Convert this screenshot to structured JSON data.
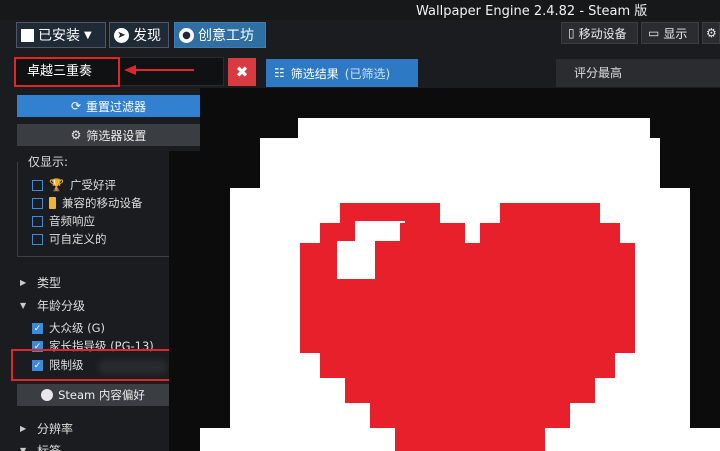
{
  "window": {
    "title": "Wallpaper Engine 2.4.82 - Steam 版"
  },
  "tabs": [
    {
      "label": "已安装",
      "icon": "save-icon",
      "active": false
    },
    {
      "label": "发现",
      "icon": "compass-icon",
      "active": false
    },
    {
      "label": "创意工坊",
      "icon": "steam-icon",
      "active": true
    }
  ],
  "right_buttons": {
    "mobile": "移动设备",
    "display": "显示"
  },
  "search": {
    "value": "卓越三重奏"
  },
  "filter_results": {
    "label": "筛选结果",
    "status": "(已筛选)"
  },
  "sort": {
    "selected": "评分最高"
  },
  "left": {
    "reset_label": "重置过滤器",
    "settings_label": "筛选器设置",
    "show_only_title": "仅显示:",
    "show_only": [
      {
        "label": "广受好评",
        "icon": "trophy-icon"
      },
      {
        "label": "兼容的移动设备",
        "icon": "phone-icon"
      },
      {
        "label": "音频响应",
        "icon": ""
      },
      {
        "label": "可自定义的",
        "icon": ""
      }
    ],
    "sections": {
      "type": "类型",
      "age": "年龄分级",
      "resolution": "分辨率",
      "tags": "标签"
    },
    "age_ratings": [
      {
        "label": "大众级 (G)",
        "checked": true
      },
      {
        "label": "家长指导级 (PG-13)",
        "checked": true
      },
      {
        "label": "限制级",
        "checked": true
      }
    ],
    "steam_pref_label": "Steam 内容偏好"
  },
  "colors": {
    "accent": "#2d79c4",
    "danger": "#d83a3f",
    "heart": "#e8202c"
  }
}
